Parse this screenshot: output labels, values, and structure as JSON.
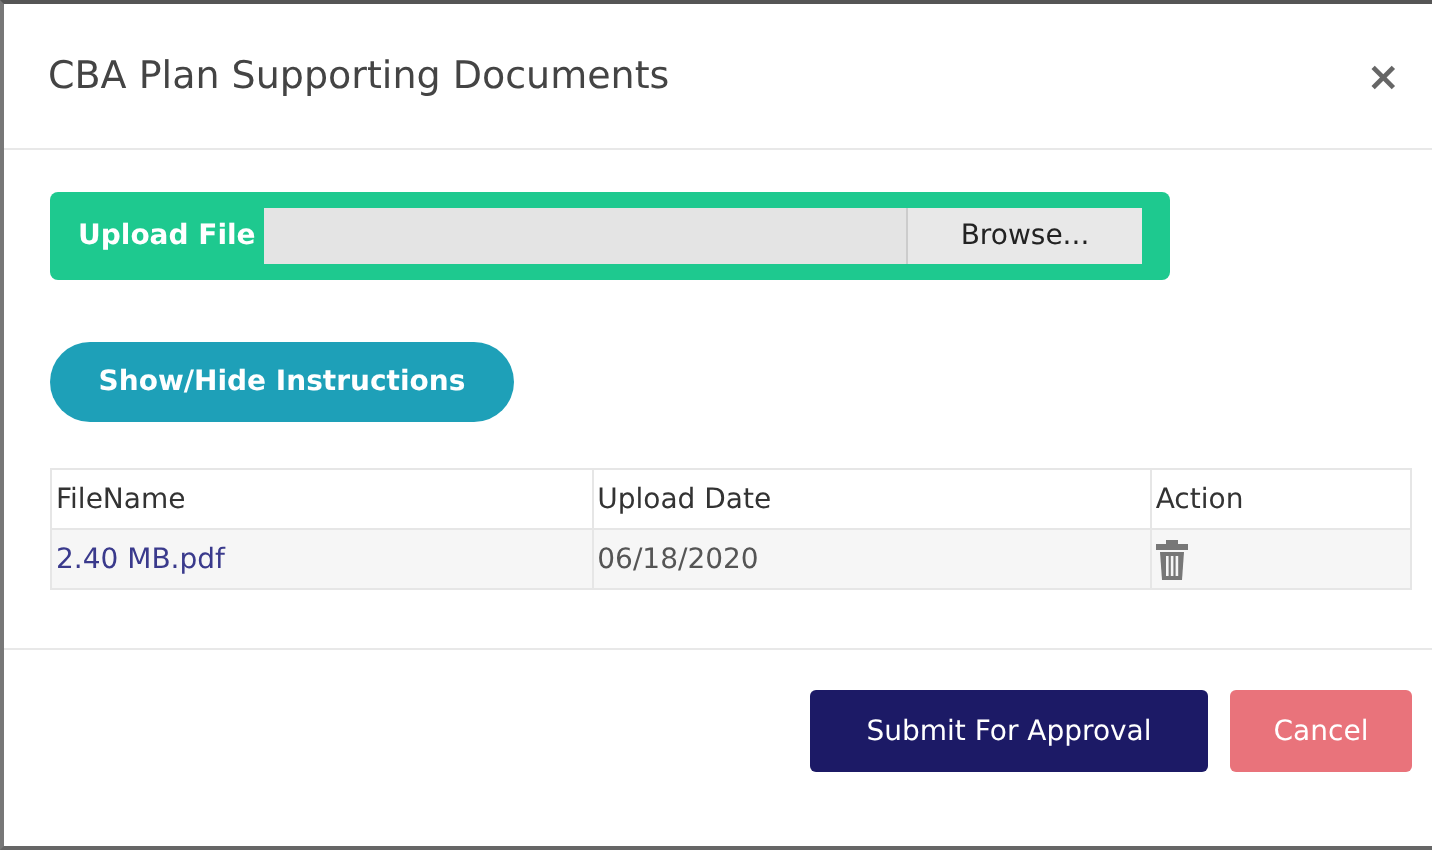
{
  "dialog": {
    "title": "CBA Plan Supporting Documents",
    "close": "×"
  },
  "upload": {
    "label": "Upload File",
    "browse": "Browse..."
  },
  "instructions_button": "Show/Hide Instructions",
  "table": {
    "columns": [
      "FileName",
      "Upload Date",
      "Action"
    ],
    "rows": [
      {
        "file": "2.40 MB.pdf",
        "date": "06/18/2020"
      }
    ]
  },
  "footer": {
    "buttons": [
      {
        "label": "Submit For Approval",
        "kind": "primary"
      },
      {
        "label": "Cancel",
        "kind": "danger"
      }
    ]
  }
}
